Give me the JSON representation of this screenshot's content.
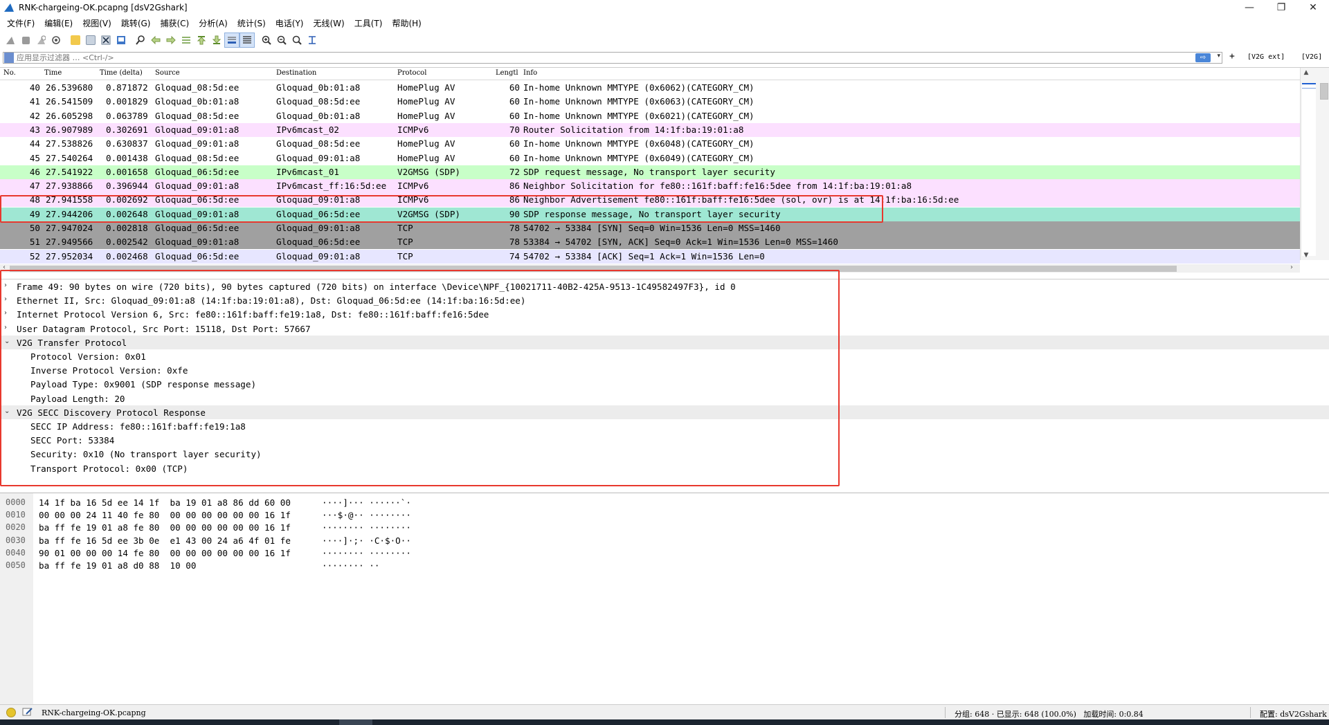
{
  "window": {
    "title": "RNK-chargeing-OK.pcapng [dsV2Gshark]",
    "minimize_glyph": "—",
    "maximize_glyph": "❐",
    "close_glyph": "✕"
  },
  "menu": [
    "文件(F)",
    "编辑(E)",
    "视图(V)",
    "跳转(G)",
    "捕获(C)",
    "分析(A)",
    "统计(S)",
    "电话(Y)",
    "无线(W)",
    "工具(T)",
    "帮助(H)"
  ],
  "toolbar": {
    "icons": [
      "shark-fin-start-icon",
      "stop-capture-icon",
      "restart-capture-icon",
      "capture-options-icon",
      "open-file-icon",
      "save-file-icon",
      "close-file-icon",
      "reload-file-icon",
      "find-packet-icon",
      "go-back-icon",
      "go-forward-icon",
      "go-to-packet-icon",
      "go-first-icon",
      "go-last-icon",
      "auto-scroll-icon",
      "colorize-icon",
      "zoom-in-icon",
      "zoom-out-icon",
      "normal-size-icon",
      "resize-columns-icon"
    ]
  },
  "filter": {
    "placeholder": "应用显示过滤器 … <Ctrl-/>",
    "apply_arrow": "⇨",
    "dropdown_glyph": "▾",
    "add_button": "+",
    "buttons": [
      "[V2G ext]",
      "[V2G]"
    ]
  },
  "packet_list": {
    "columns": [
      "No.",
      "Time",
      "Time (delta)",
      "Source",
      "Destination",
      "Protocol",
      "Lengtl",
      "Info"
    ],
    "rows": [
      {
        "no": "40",
        "time": "26.539680",
        "delta": "0.871872",
        "src": "Gloquad_08:5d:ee",
        "dst": "Gloquad_0b:01:a8",
        "proto": "HomePlug AV",
        "len": "60",
        "info": "In-home Unknown MMTYPE (0x6062)(CATEGORY_CM)",
        "bg": "#ffffff",
        "fg": "#000000"
      },
      {
        "no": "41",
        "time": "26.541509",
        "delta": "0.001829",
        "src": "Gloquad_0b:01:a8",
        "dst": "Gloquad_08:5d:ee",
        "proto": "HomePlug AV",
        "len": "60",
        "info": "In-home Unknown MMTYPE (0x6063)(CATEGORY_CM)",
        "bg": "#ffffff",
        "fg": "#000000"
      },
      {
        "no": "42",
        "time": "26.605298",
        "delta": "0.063789",
        "src": "Gloquad_08:5d:ee",
        "dst": "Gloquad_0b:01:a8",
        "proto": "HomePlug AV",
        "len": "60",
        "info": "In-home Unknown MMTYPE (0x6021)(CATEGORY_CM)",
        "bg": "#ffffff",
        "fg": "#000000"
      },
      {
        "no": "43",
        "time": "26.907989",
        "delta": "0.302691",
        "src": "Gloquad_09:01:a8",
        "dst": "IPv6mcast_02",
        "proto": "ICMPv6",
        "len": "70",
        "info": "Router Solicitation from 14:1f:ba:19:01:a8",
        "bg": "#fce0ff",
        "fg": "#000000"
      },
      {
        "no": "44",
        "time": "27.538826",
        "delta": "0.630837",
        "src": "Gloquad_09:01:a8",
        "dst": "Gloquad_08:5d:ee",
        "proto": "HomePlug AV",
        "len": "60",
        "info": "In-home Unknown MMTYPE (0x6048)(CATEGORY_CM)",
        "bg": "#ffffff",
        "fg": "#000000"
      },
      {
        "no": "45",
        "time": "27.540264",
        "delta": "0.001438",
        "src": "Gloquad_08:5d:ee",
        "dst": "Gloquad_09:01:a8",
        "proto": "HomePlug AV",
        "len": "60",
        "info": "In-home Unknown MMTYPE (0x6049)(CATEGORY_CM)",
        "bg": "#ffffff",
        "fg": "#000000"
      },
      {
        "no": "46",
        "time": "27.541922",
        "delta": "0.001658",
        "src": "Gloquad_06:5d:ee",
        "dst": "IPv6mcast_01",
        "proto": "V2GMSG (SDP)",
        "len": "72",
        "info": "SDP request message, No transport layer security",
        "bg": "#c8ffc8",
        "fg": "#000000"
      },
      {
        "no": "47",
        "time": "27.938866",
        "delta": "0.396944",
        "src": "Gloquad_09:01:a8",
        "dst": "IPv6mcast_ff:16:5d:ee",
        "proto": "ICMPv6",
        "len": "86",
        "info": "Neighbor Solicitation for fe80::161f:baff:fe16:5dee from 14:1f:ba:19:01:a8",
        "bg": "#fce0ff",
        "fg": "#000000"
      },
      {
        "no": "48",
        "time": "27.941558",
        "delta": "0.002692",
        "src": "Gloquad_06:5d:ee",
        "dst": "Gloquad_09:01:a8",
        "proto": "ICMPv6",
        "len": "86",
        "info": "Neighbor Advertisement fe80::161f:baff:fe16:5dee (sol, ovr) is at 14:1f:ba:16:5d:ee",
        "bg": "#fce0ff",
        "fg": "#000000"
      },
      {
        "no": "49",
        "time": "27.944206",
        "delta": "0.002648",
        "src": "Gloquad_09:01:a8",
        "dst": "Gloquad_06:5d:ee",
        "proto": "V2GMSG (SDP)",
        "len": "90",
        "info": "SDP response message, No transport layer security",
        "bg": "#9fe7d3",
        "fg": "#000000"
      },
      {
        "no": "50",
        "time": "27.947024",
        "delta": "0.002818",
        "src": "Gloquad_06:5d:ee",
        "dst": "Gloquad_09:01:a8",
        "proto": "TCP",
        "len": "78",
        "info": "54702 → 53384 [SYN] Seq=0 Win=1536 Len=0 MSS=1460",
        "bg": "#a0a0a0",
        "fg": "#000000"
      },
      {
        "no": "51",
        "time": "27.949566",
        "delta": "0.002542",
        "src": "Gloquad_09:01:a8",
        "dst": "Gloquad_06:5d:ee",
        "proto": "TCP",
        "len": "78",
        "info": "53384 → 54702 [SYN, ACK] Seq=0 Ack=1 Win=1536 Len=0 MSS=1460",
        "bg": "#a0a0a0",
        "fg": "#000000"
      },
      {
        "no": "52",
        "time": "27.952034",
        "delta": "0.002468",
        "src": "Gloquad_06:5d:ee",
        "dst": "Gloquad_09:01:a8",
        "proto": "TCP",
        "len": "74",
        "info": "54702 → 53384 [ACK] Seq=1 Ack=1 Win=1536 Len=0",
        "bg": "#e7e6ff",
        "fg": "#000000"
      }
    ]
  },
  "details": [
    {
      "text": "Frame 49: 90 bytes on wire (720 bits), 90 bytes captured (720 bits) on interface \\Device\\NPF_{10021711-40B2-425A-9513-1C49582497F3}, id 0",
      "level": 0,
      "toggle": "›",
      "section": false
    },
    {
      "text": "Ethernet II, Src: Gloquad_09:01:a8 (14:1f:ba:19:01:a8), Dst: Gloquad_06:5d:ee (14:1f:ba:16:5d:ee)",
      "level": 0,
      "toggle": "›",
      "section": false
    },
    {
      "text": "Internet Protocol Version 6, Src: fe80::161f:baff:fe19:1a8, Dst: fe80::161f:baff:fe16:5dee",
      "level": 0,
      "toggle": "›",
      "section": false
    },
    {
      "text": "User Datagram Protocol, Src Port: 15118, Dst Port: 57667",
      "level": 0,
      "toggle": "›",
      "section": false
    },
    {
      "text": "V2G Transfer Protocol",
      "level": 0,
      "toggle": "⌄",
      "section": true
    },
    {
      "text": "Protocol Version: 0x01",
      "level": 1,
      "toggle": "",
      "section": false
    },
    {
      "text": "Inverse Protocol Version: 0xfe",
      "level": 1,
      "toggle": "",
      "section": false
    },
    {
      "text": "Payload Type: 0x9001 (SDP response message)",
      "level": 1,
      "toggle": "",
      "section": false
    },
    {
      "text": "Payload Length: 20",
      "level": 1,
      "toggle": "",
      "section": false
    },
    {
      "text": "V2G SECC Discovery Protocol Response",
      "level": 0,
      "toggle": "⌄",
      "section": true
    },
    {
      "text": "SECC IP Address: fe80::161f:baff:fe19:1a8",
      "level": 1,
      "toggle": "",
      "section": false
    },
    {
      "text": "SECC Port: 53384",
      "level": 1,
      "toggle": "",
      "section": false
    },
    {
      "text": "Security: 0x10 (No transport layer security)",
      "level": 1,
      "toggle": "",
      "section": false
    },
    {
      "text": "Transport Protocol: 0x00 (TCP)",
      "level": 1,
      "toggle": "",
      "section": false
    }
  ],
  "hex": [
    {
      "offset": "0000",
      "bytes": "14 1f ba 16 5d ee 14 1f  ba 19 01 a8 86 dd 60 00",
      "ascii": "····]··· ······`·"
    },
    {
      "offset": "0010",
      "bytes": "00 00 00 24 11 40 fe 80  00 00 00 00 00 00 16 1f",
      "ascii": "···$·@·· ········"
    },
    {
      "offset": "0020",
      "bytes": "ba ff fe 19 01 a8 fe 80  00 00 00 00 00 00 16 1f",
      "ascii": "········ ········"
    },
    {
      "offset": "0030",
      "bytes": "ba ff fe 16 5d ee 3b 0e  e1 43 00 24 a6 4f 01 fe",
      "ascii": "····]·;· ·C·$·O··"
    },
    {
      "offset": "0040",
      "bytes": "90 01 00 00 00 14 fe 80  00 00 00 00 00 00 16 1f",
      "ascii": "········ ········"
    },
    {
      "offset": "0050",
      "bytes": "ba ff fe 19 01 a8 d0 88  10 00",
      "ascii": "········ ··"
    }
  ],
  "status": {
    "file": "RNK-chargeing-OK.pcapng",
    "packets": "分组: 648 · 已显示: 648 (100.0%)   加载时间: 0:0.84",
    "profile": "配置: dsV2Gshark"
  },
  "colors": {
    "annotation": "#e8382e",
    "sdp_selected": "#9fe7d3",
    "sdp": "#c8ffc8",
    "icmpv6": "#fce0ff",
    "tcp_syn": "#a0a0a0",
    "tcp": "#e7e6ff"
  }
}
